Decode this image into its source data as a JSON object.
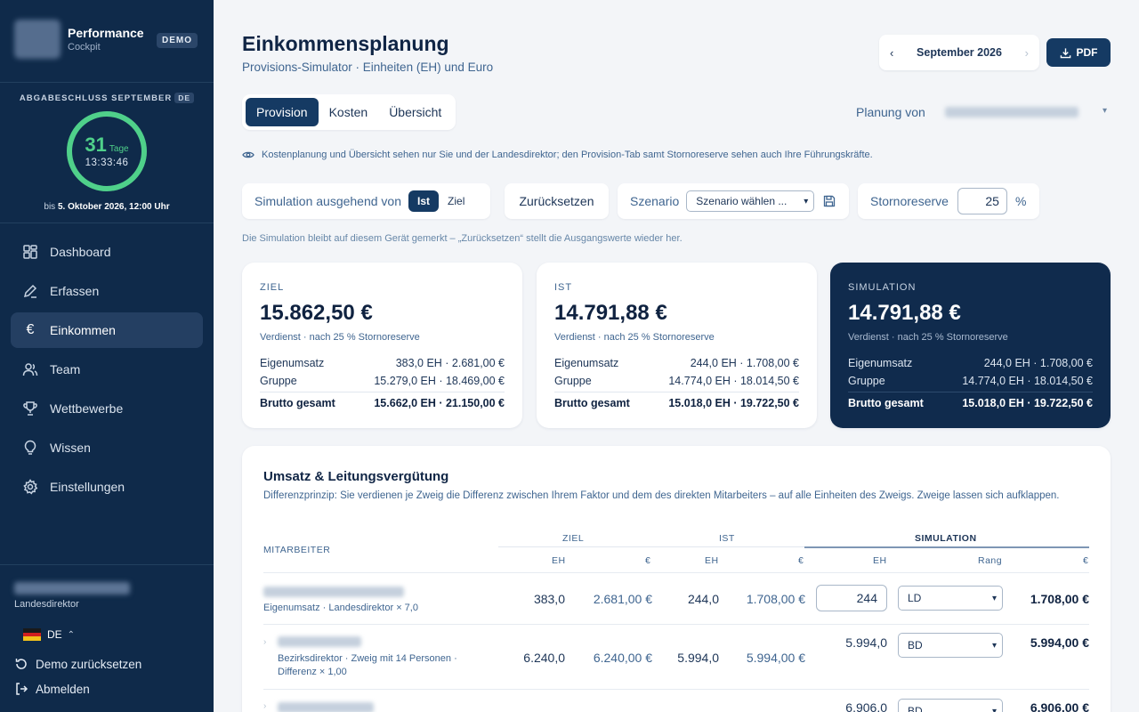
{
  "sidebar": {
    "app_name": "Performance",
    "app_sub": "Cockpit",
    "demo_badge": "DEMO",
    "deadline_label": "ABGABESCHLUSS SEPTEMBER",
    "deadline_lang": "DE",
    "countdown_days": "31",
    "countdown_days_unit": "Tage",
    "countdown_time": "13:33:46",
    "countdown_progress": 1.0,
    "until_prefix": "bis",
    "until_date": "5. Oktober 2026, 12:00 Uhr",
    "nav": [
      {
        "label": "Dashboard",
        "icon": "grid-icon",
        "active": false
      },
      {
        "label": "Erfassen",
        "icon": "pencil-icon",
        "active": false
      },
      {
        "label": "Einkommen",
        "icon": "euro-icon",
        "active": true
      },
      {
        "label": "Team",
        "icon": "users-icon",
        "active": false
      },
      {
        "label": "Wettbewerbe",
        "icon": "trophy-icon",
        "active": false
      },
      {
        "label": "Wissen",
        "icon": "lightbulb-icon",
        "active": false
      },
      {
        "label": "Einstellungen",
        "icon": "gear-icon",
        "active": false
      }
    ],
    "user_role": "Landesdirektor",
    "language": "DE",
    "reset_demo": "Demo zurücksetzen",
    "logout": "Abmelden"
  },
  "header": {
    "title": "Einkommensplanung",
    "subtitle": "Provisions-Simulator · Einheiten (EH) und Euro",
    "month": "September 2026",
    "pdf_label": "PDF"
  },
  "tabs": [
    {
      "label": "Provision",
      "active": true
    },
    {
      "label": "Kosten",
      "active": false
    },
    {
      "label": "Übersicht",
      "active": false
    }
  ],
  "plan_label": "Planung von",
  "visibility_note": "Kostenplanung und Übersicht sehen nur Sie und der Landesdirektor; den Provision-Tab samt Stornoreserve sehen auch Ihre Führungskräfte.",
  "controls": {
    "simulation_label": "Simulation ausgehend von",
    "sim_options": [
      {
        "label": "Ist",
        "active": true
      },
      {
        "label": "Ziel",
        "active": false
      }
    ],
    "reset_label": "Zurücksetzen",
    "scenario_label": "Szenario",
    "scenario_value": "Szenario wählen ...",
    "storno_label": "Stornoreserve",
    "storno_value": "25",
    "storno_unit": "%"
  },
  "sim_note": "Die Simulation bleibt auf diesem Gerät gemerkt – „Zurücksetzen“ stellt die Ausgangswerte wieder her.",
  "kpis": [
    {
      "label": "ZIEL",
      "value": "15.862,50 €",
      "sub": "Verdienst · nach 25 % Stornoreserve",
      "rows": [
        {
          "k": "Eigenumsatz",
          "v": "383,0 EH · 2.681,00 €"
        },
        {
          "k": "Gruppe",
          "v": "15.279,0 EH · 18.469,00 €"
        }
      ],
      "total": {
        "k": "Brutto gesamt",
        "v": "15.662,0 EH · 21.150,00 €"
      }
    },
    {
      "label": "IST",
      "value": "14.791,88 €",
      "sub": "Verdienst · nach 25 % Stornoreserve",
      "rows": [
        {
          "k": "Eigenumsatz",
          "v": "244,0 EH · 1.708,00 €"
        },
        {
          "k": "Gruppe",
          "v": "14.774,0 EH · 18.014,50 €"
        }
      ],
      "total": {
        "k": "Brutto gesamt",
        "v": "15.018,0 EH · 19.722,50 €"
      }
    },
    {
      "label": "SIMULATION",
      "value": "14.791,88 €",
      "sub": "Verdienst · nach 25 % Stornoreserve",
      "rows": [
        {
          "k": "Eigenumsatz",
          "v": "244,0 EH · 1.708,00 €"
        },
        {
          "k": "Gruppe",
          "v": "14.774,0 EH · 18.014,50 €"
        }
      ],
      "total": {
        "k": "Brutto gesamt",
        "v": "15.018,0 EH · 19.722,50 €"
      }
    }
  ],
  "table": {
    "title": "Umsatz & Leitungsvergütung",
    "description": "Differenzprinzip: Sie verdienen je Zweig die Differenz zwischen Ihrem Faktor und dem des direkten Mitarbeiters – auf alle Einheiten des Zweigs. Zweige lassen sich aufklappen.",
    "col_employee": "MITARBEITER",
    "groups": {
      "ziel": "ZIEL",
      "ist": "IST",
      "sim": "SIMULATION"
    },
    "sub_cols": {
      "eh": "EH",
      "eur": "€",
      "rang": "Rang"
    },
    "rows": [
      {
        "sub": "Eigenumsatz · Landesdirektor × 7,0",
        "ziel_eh": "383,0",
        "ziel_eur": "2.681,00 €",
        "ist_eh": "244,0",
        "ist_eur": "1.708,00 €",
        "sim_eh": "244",
        "sim_rang": "LD",
        "sim_eur": "1.708,00 €"
      },
      {
        "sub": "Bezirksdirektor · Zweig mit 14 Personen ·",
        "sub2": "Differenz × 1,00",
        "ziel_eh": "6.240,0",
        "ziel_eur": "6.240,00 €",
        "ist_eh": "5.994,0",
        "ist_eur": "5.994,00 €",
        "sim_eh": "5.994,0",
        "sim_rang": "BD",
        "sim_eur": "5.994,00 €"
      },
      {
        "sim_eh": "6.906,0",
        "sim_rang": "BD",
        "sim_eur": "6.906,00 €"
      }
    ]
  }
}
